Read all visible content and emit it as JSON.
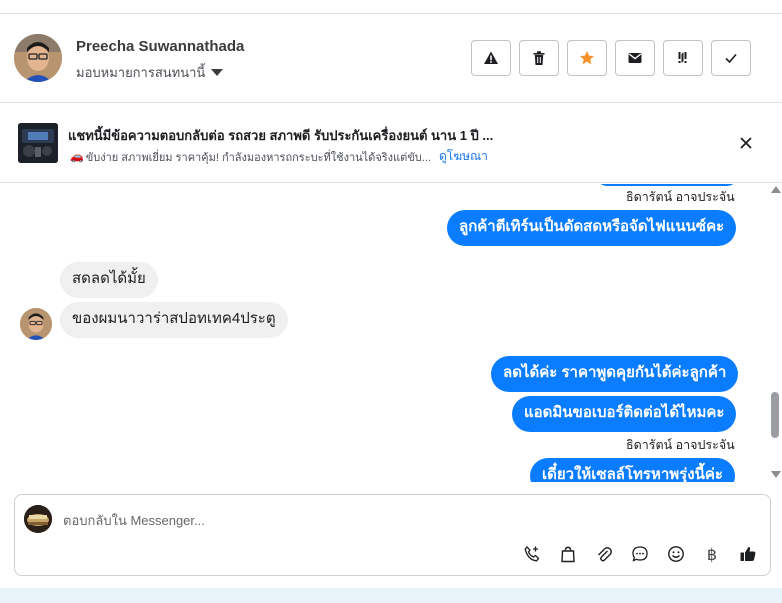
{
  "header": {
    "name": "Preecha Suwannathada",
    "assign_label": "มอบหมายการสนทนานี้"
  },
  "toolbar": {
    "buttons": [
      {
        "icon": "warning-icon",
        "color": "#1c1e21"
      },
      {
        "icon": "trash-icon",
        "color": "#1c1e21"
      },
      {
        "icon": "star-icon",
        "color": "#f5922b"
      },
      {
        "icon": "envelope-icon",
        "color": "#1c1e21"
      },
      {
        "icon": "priority-icon",
        "color": "#1c1e21"
      },
      {
        "icon": "check-icon",
        "color": "#1c1e21"
      }
    ]
  },
  "ad": {
    "title": "แชทนี้มีข้อความตอบกลับต่อ รถสวย สภาพดี รับประกันเครื่องยนต์ นาน 1 ปี ...",
    "subtitle": "ขับง่าย สภาพเยี่ยม ราคาคุ้ม! กำลังมองหารถกระบะที่ใช้งานได้จริงแต่ขับ...",
    "link": "ดูโฆษณา"
  },
  "messages": {
    "sender_name": "ธิดารัตน์ อาจประจัน",
    "m1": "ลูกค้าตีเทิร์นเป็นดัดสดหรือจัดไฟแนนซ์คะ",
    "m2": "สดลดได้มั้ย",
    "m3": "ของผมนาวาร่าสปอทเทค4ประตู",
    "m4": "ลดได้ค่ะ ราคาพูดคุยกันได้ค่ะลูกค้า",
    "m5": "แอดมินขอเบอร์ติดต่อได้ไหมคะ",
    "m6": "เดี๋ยวให้เซลล์โทรหาพรุ่งนี้ค่ะ"
  },
  "composer": {
    "placeholder": "ตอบกลับใน Messenger...",
    "baht_symbol": "฿"
  },
  "colors": {
    "accent": "#0a7cff",
    "link": "#1876f2"
  }
}
